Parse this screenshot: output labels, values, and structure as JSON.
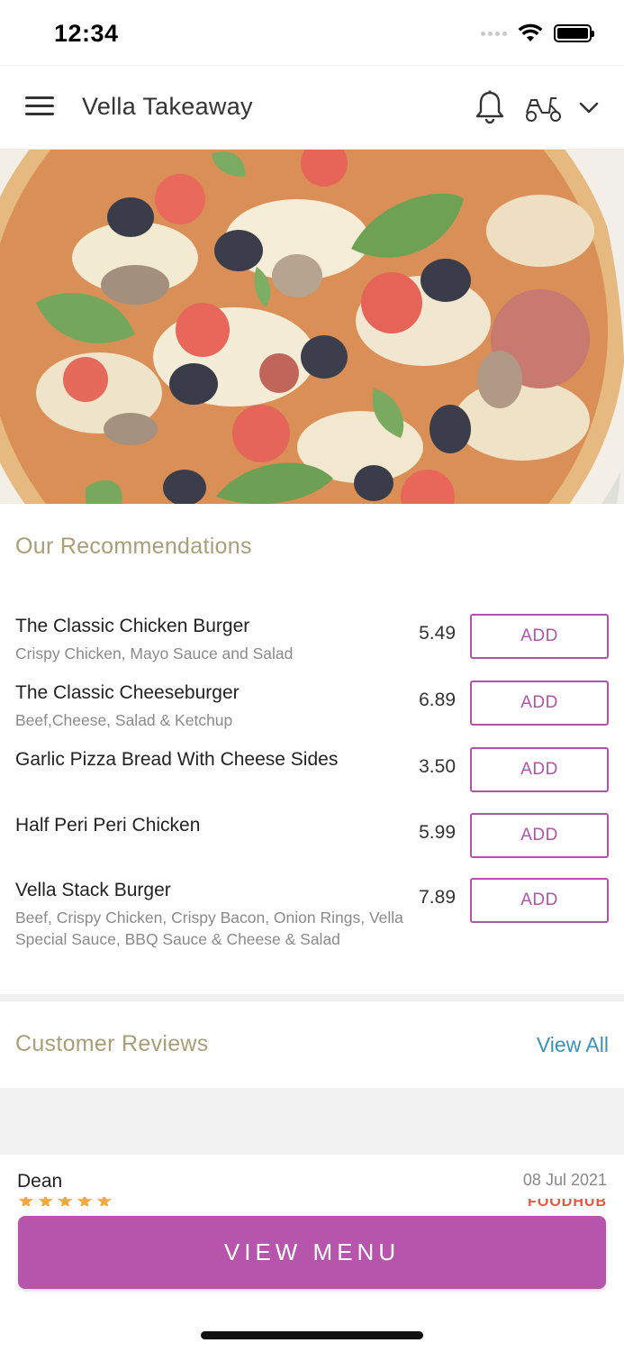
{
  "status_bar": {
    "time": "12:34",
    "icons": [
      "cellular-dots-icon",
      "wifi-icon",
      "battery-icon"
    ],
    "battery_level": 1.0
  },
  "header": {
    "title": "Vella Takeaway",
    "icons": [
      "hamburger-menu-icon",
      "bell-icon",
      "scooter-icon",
      "chevron-down-icon"
    ]
  },
  "hero": {
    "image": "pizza-photo"
  },
  "recommendations": {
    "title": "Our Recommendations",
    "add_label": "ADD",
    "items": [
      {
        "name": "The Classic Chicken Burger",
        "description": "Crispy Chicken, Mayo Sauce and Salad",
        "price": "5.49"
      },
      {
        "name": "The Classic Cheeseburger",
        "description": "Beef,Cheese, Salad & Ketchup",
        "price": "6.89"
      },
      {
        "name": "Garlic Pizza Bread With Cheese Sides",
        "description": "",
        "price": "3.50"
      },
      {
        "name": "Half Peri Peri Chicken",
        "description": "",
        "price": "5.99"
      },
      {
        "name": "Vella Stack Burger",
        "description": "Beef, Crispy Chicken, Crispy Bacon, Onion Rings, Vella Special Sauce, BBQ Sauce & Cheese & Salad",
        "price": "7.89"
      }
    ]
  },
  "reviews": {
    "title": "Customer Reviews",
    "view_all": "View All",
    "first_review": {
      "name": "Dean",
      "date": "08 Jul 2021",
      "stars": "★★★★★",
      "source": "FOODHUB"
    }
  },
  "footer": {
    "view_menu": "VIEW MENU"
  },
  "colors": {
    "accent": "#b755ad",
    "section_title": "#a99e78",
    "link": "#3a92b6"
  }
}
